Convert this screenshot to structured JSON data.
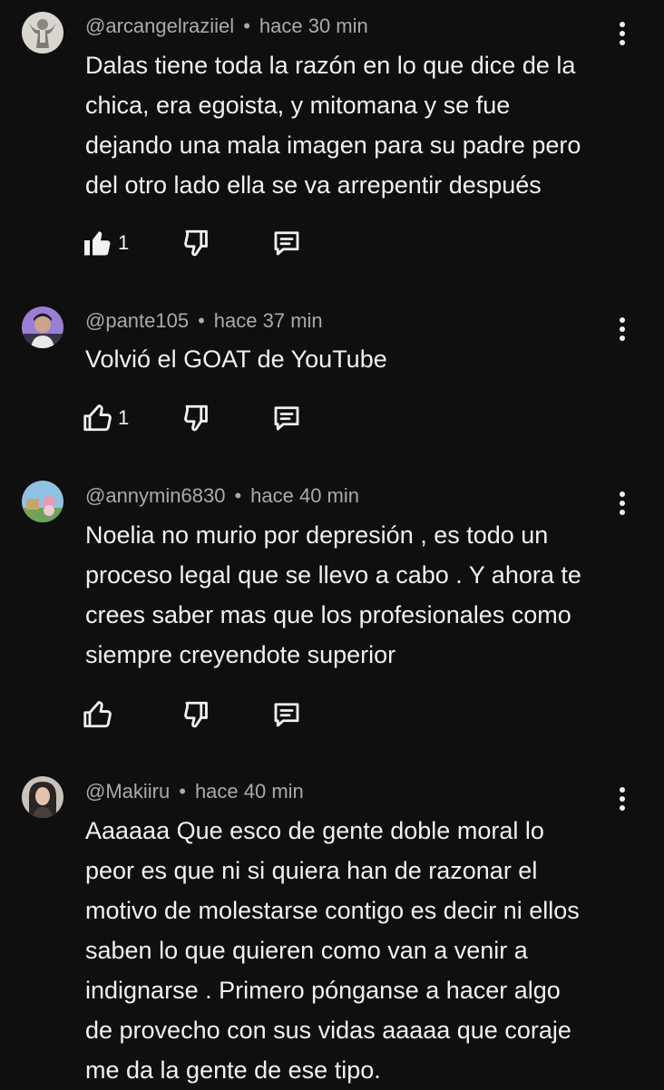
{
  "comments": [
    {
      "handle": "@arcangelraziiel",
      "time": "hace 30 min",
      "text": "Dalas tiene toda la razón en lo que dice de la\nchica, era egoista, y mitomana y se fue\ndejando una mala imagen para su padre pero\ndel otro lado ella se va arrepentir después",
      "likes": "1",
      "liked": true,
      "avatar_icon": "angel-statue-avatar"
    },
    {
      "handle": "@pante105",
      "time": "hace 37 min",
      "text": "Volvió el GOAT de YouTube",
      "likes": "1",
      "liked": false,
      "avatar_icon": "person-photo-avatar"
    },
    {
      "handle": "@annymin6830",
      "time": "hace 40 min",
      "text": "Noelia no murio por depresión , es todo un\nproceso legal que se llevo a cabo . Y ahora te\ncrees saber mas que los profesionales como\nsiempre creyendote superior",
      "likes": "",
      "liked": false,
      "avatar_icon": "cartoon-avatar"
    },
    {
      "handle": "@Makiiru",
      "time": "hace 40 min",
      "text": "Aaaaaa Que esco de gente doble moral lo\npeor es que ni si quiera han de razonar el\nmotivo de molestarse contigo es decir ni ellos\nsaben lo que quieren como van a venir a\nindignarse . Primero pónganse  a hacer algo\nde provecho  con sus vidas aaaaa que coraje\nme da la gente de ese tipo.",
      "likes": "",
      "liked": false,
      "avatar_icon": "person-photo-avatar"
    }
  ],
  "separator": "•"
}
